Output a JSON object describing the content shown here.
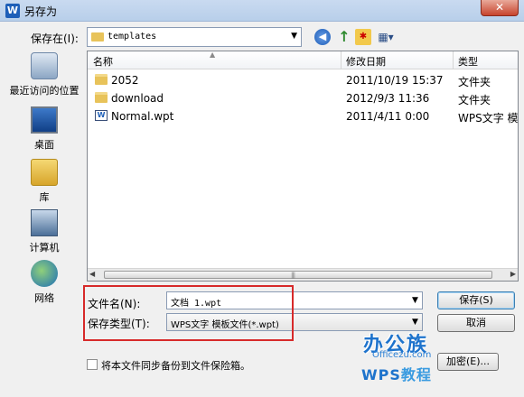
{
  "window": {
    "title": "另存为",
    "app_icon_letter": "W",
    "close_glyph": "✕"
  },
  "location": {
    "label": "保存在(I):",
    "value": "templates"
  },
  "toolbar": {
    "back_glyph": "◀",
    "up_glyph": "↑",
    "new_folder_glyph": "✱",
    "view_glyph": "▦▾"
  },
  "places": [
    {
      "label": "最近访问的位置",
      "icon": "recent-places-icon"
    },
    {
      "label": "桌面",
      "icon": "desktop-icon"
    },
    {
      "label": "库",
      "icon": "library-icon"
    },
    {
      "label": "计算机",
      "icon": "computer-icon"
    },
    {
      "label": "网络",
      "icon": "network-icon"
    }
  ],
  "columns": {
    "name": "名称",
    "date": "修改日期",
    "type": "类型"
  },
  "files": [
    {
      "name": "2052",
      "date": "2011/10/19 15:37",
      "type": "文件夹",
      "icon": "folder-icon"
    },
    {
      "name": "download",
      "date": "2012/9/3 11:36",
      "type": "文件夹",
      "icon": "folder-icon"
    },
    {
      "name": "Normal.wpt",
      "date": "2011/4/11 0:00",
      "type": "WPS文字 模",
      "icon": "wps-document-icon"
    }
  ],
  "filename": {
    "label": "文件名(N):",
    "value": "文档 1.wpt"
  },
  "filetype": {
    "label": "保存类型(T):",
    "value": "WPS文字 模板文件(*.wpt)"
  },
  "buttons": {
    "save": "保存(S)",
    "cancel": "取消",
    "encrypt": "加密(E)..."
  },
  "backup": {
    "label": "将本文件同步备份到文件保险箱。",
    "checked": false
  },
  "watermark": {
    "line1": "办公族",
    "line2": "Officezu.com",
    "line3a": "WPS",
    "line3b": "教程"
  }
}
